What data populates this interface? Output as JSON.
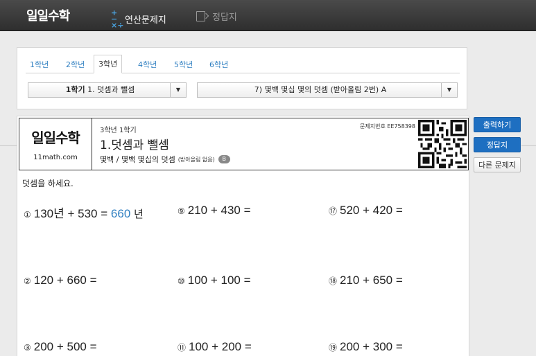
{
  "nav": {
    "logo": "일일수학",
    "problems_label": "연산문제지",
    "problems_icon": "plus-minus-times-divide-icon",
    "answers_label": "정답지",
    "answers_icon": "document-arrow-icon"
  },
  "tabs": [
    {
      "label": "1학년",
      "active": false
    },
    {
      "label": "2학년",
      "active": false
    },
    {
      "label": "3학년",
      "active": true
    },
    {
      "label": "4학년",
      "active": false
    },
    {
      "label": "5학년",
      "active": false
    },
    {
      "label": "6학년",
      "active": false
    }
  ],
  "selects": {
    "unit_value": "1학기 1. 덧셈과 뺄셈",
    "unit_value_bold": "1학기",
    "unit_value_rest": " 1. 덧셈과 뺄셈",
    "topic_value": "7) 몇백 몇십 몇의 덧셈 (받아올림 2번) A"
  },
  "sheet": {
    "brand_logo": "일일수학",
    "brand_url": "11math.com",
    "grade_sub": "3학년 1학기",
    "unit_title": "1.덧셈과 뺄셈",
    "unit_detail": "몇백 / 몇백 몇십의 덧셈",
    "unit_note": "(받아올림 없음)",
    "level_badge": "B",
    "sheet_no": "문제지번호 EE758398",
    "instruction": "덧셈을 하세요."
  },
  "problems": [
    {
      "num": "①",
      "expr": "130년 + 530 =",
      "answer": "660",
      "unit": "년"
    },
    {
      "num": "②",
      "expr": "120 + 660 =",
      "answer": "",
      "unit": ""
    },
    {
      "num": "③",
      "expr": "200 + 500 =",
      "answer": "",
      "unit": ""
    },
    {
      "num": "⑨",
      "expr": "210 + 430 =",
      "answer": "",
      "unit": ""
    },
    {
      "num": "⑩",
      "expr": "100 + 100 =",
      "answer": "",
      "unit": ""
    },
    {
      "num": "⑪",
      "expr": "100 + 200 =",
      "answer": "",
      "unit": ""
    },
    {
      "num": "⑰",
      "expr": "520 + 420 =",
      "answer": "",
      "unit": ""
    },
    {
      "num": "⑱",
      "expr": "210 + 650 =",
      "answer": "",
      "unit": ""
    },
    {
      "num": "⑲",
      "expr": "200 + 300 =",
      "answer": "",
      "unit": ""
    }
  ],
  "actions": {
    "print": "출력하기",
    "answer": "정답지",
    "other": "다른 문제지"
  },
  "colors": {
    "accent_blue": "#1e6fc1",
    "link_blue": "#2f7fc1",
    "topbar": "#3a3a3a"
  }
}
